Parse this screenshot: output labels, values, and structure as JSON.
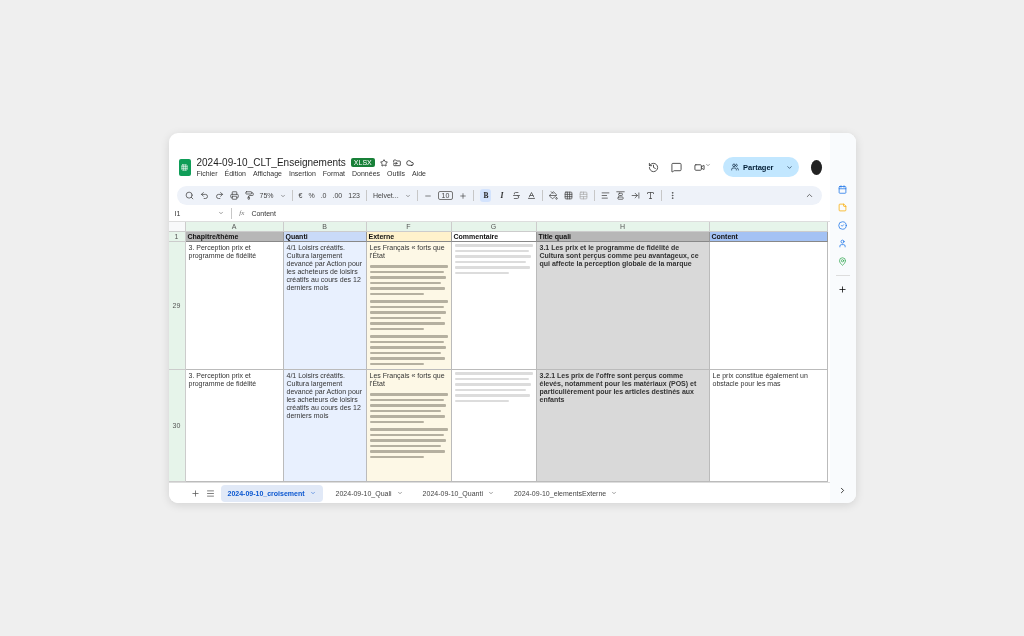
{
  "document": {
    "title": "2024-09-10_CLT_Enseignements",
    "badge": "XLSX"
  },
  "menu": [
    "Fichier",
    "Édition",
    "Affichage",
    "Insertion",
    "Format",
    "Données",
    "Outils",
    "Aide"
  ],
  "share_button": "Partager",
  "toolbar": {
    "zoom": "75%",
    "currency": "€",
    "percent": "%",
    "decrease_decimal": ".0",
    "increase_decimal": ".00",
    "number_format": "123",
    "font": "Helvet...",
    "font_size": "10",
    "bold": {
      "label": "B",
      "on": true
    },
    "italic": {
      "label": "I",
      "on": false
    }
  },
  "formula_bar": {
    "cell": "I1",
    "function_label": "fx",
    "value": "Content"
  },
  "columns": [
    {
      "letter": "A",
      "kind": "plain",
      "color": "#ffffff"
    },
    {
      "letter": "B",
      "kind": "plain",
      "color": "#e8f0fe"
    },
    {
      "letter": "F",
      "kind": "plain",
      "color": "#fdf8e6"
    },
    {
      "letter": "G",
      "kind": "muted",
      "color": "#ffffff"
    },
    {
      "letter": "H",
      "kind": "bold",
      "color": "#d9d9d9"
    },
    {
      "kind": "plain",
      "color": "#ffffff"
    }
  ],
  "header_row": {
    "number": "1",
    "cells": [
      {
        "text": "Chapitre/thème",
        "color": "#b7b7b7"
      },
      {
        "text": "Quanti",
        "color": "#c9daf8"
      },
      {
        "text": "Externe",
        "color": "#fff2cc"
      },
      {
        "text": "Commentaire",
        "color": "#ffffff"
      },
      {
        "text": "Title quali",
        "color": "#b7b7b7"
      },
      {
        "text": "Content",
        "color": "#a4c2f4"
      }
    ]
  },
  "rows": [
    {
      "number": "29",
      "cells": [
        [
          {
            "kind": "text",
            "text": "3. Perception prix et programme de fidélité"
          }
        ],
        [
          {
            "kind": "text",
            "text": "4/1 Loisirs créatifs. Cultura largement devancé par Action pour les acheteurs de loisirs créatifs au cours des 12 derniers mois"
          }
        ],
        [
          {
            "kind": "text",
            "text": "Les Français « forts que l'État"
          },
          {
            "kind": "blurred"
          },
          {
            "kind": "blurred"
          },
          {
            "kind": "blurred"
          }
        ],
        [
          {
            "kind": "blurred"
          }
        ],
        [
          {
            "kind": "text",
            "text": "3.1 Les prix et le programme de fidélité de Cultura sont perçus comme peu avantageux, ce qui affecte la perception globale de la marque"
          }
        ],
        []
      ]
    },
    {
      "number": "30",
      "cells": [
        [
          {
            "kind": "text",
            "text": "3. Perception prix et programme de fidélité"
          }
        ],
        [
          {
            "kind": "text",
            "text": "4/1 Loisirs créatifs. Cultura largement devancé par Action pour les acheteurs de loisirs créatifs au cours des 12 derniers mois"
          }
        ],
        [
          {
            "kind": "text",
            "text": "Les Français « forts que l'État"
          },
          {
            "kind": "blurred"
          },
          {
            "kind": "blurred"
          }
        ],
        [
          {
            "kind": "blurred"
          }
        ],
        [
          {
            "kind": "text",
            "text": "3.2.1 Les prix de l'offre sont perçus comme élevés, notamment pour les matériaux (POS) et particulièrement pour les articles destinés aux enfants"
          }
        ],
        [
          {
            "kind": "text",
            "text": "Le prix constitue également un obstacle pour les mas"
          }
        ]
      ]
    }
  ],
  "sheet_tabs": [
    {
      "label": "2024-09-10_croisement",
      "selected": true
    },
    {
      "label": "2024-09-10_Quali",
      "selected": false
    },
    {
      "label": "2024-09-10_Quanti",
      "selected": false
    },
    {
      "label": "2024-09-10_elementsExterne",
      "selected": false
    }
  ]
}
